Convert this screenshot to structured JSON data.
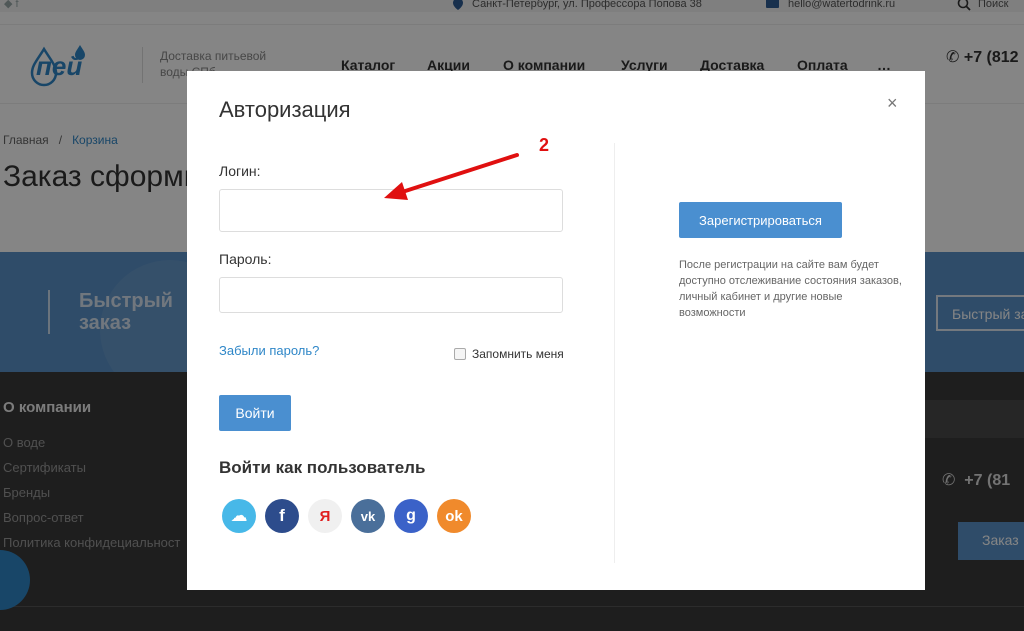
{
  "topbar": {
    "social": "◆ f",
    "address": "Санкт-Петербург, ул. Профессора Попова 38",
    "email": "hello@watertodrink.ru",
    "search": "Поиск"
  },
  "header": {
    "logo": "пей",
    "tagline": "Доставка питьевой воды СПб",
    "nav": [
      "Каталог",
      "Акции",
      "О компании",
      "Услуги",
      "Доставка",
      "Оплата",
      "…"
    ],
    "phone": "+7 (812"
  },
  "breadcrumb": {
    "home": "Главная",
    "sep": "/",
    "cart": "Корзина"
  },
  "page_title": "Заказ сформи",
  "band": {
    "title_line1": "Быстрый",
    "title_line2": "заказ",
    "button": "Быстрый за"
  },
  "footer": {
    "heading": "О компании",
    "links": [
      "О воде",
      "Сертификаты",
      "Бренды",
      "Вопрос-ответ",
      "Политика конфидециальност"
    ],
    "phone": "+7 (81",
    "order_button": "Заказ"
  },
  "modal": {
    "title": "Авторизация",
    "close": "×",
    "login_label": "Логин:",
    "login_value": "",
    "password_label": "Пароль:",
    "password_value": "",
    "forgot": "Забыли пароль?",
    "remember": "Запомнить меня",
    "submit": "Войти",
    "social_title": "Войти как пользователь",
    "social_icons": [
      "cloud-icon",
      "facebook-icon",
      "yandex-icon",
      "vk-icon",
      "google-icon",
      "odnoklassniki-icon"
    ],
    "social_glyphs": [
      "☁",
      "f",
      "Я",
      "vk",
      "g",
      "ok"
    ],
    "register": "Зарегистрироваться",
    "register_note": "После регистрации на сайте вам будет доступно отслеживание состояния заказов, личный кабинет и другие новые возможности"
  },
  "annotation": {
    "number": "2"
  },
  "colors": {
    "accent": "#4a8fd0",
    "brand": "#2f87c8",
    "annotation": "#e01010",
    "band": "#5b92c9",
    "footer": "#3a3a3a"
  }
}
